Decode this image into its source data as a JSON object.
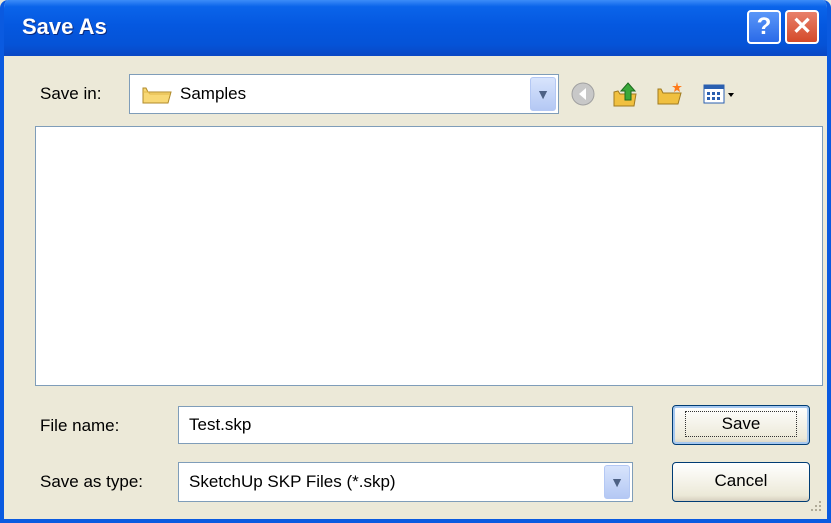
{
  "window": {
    "title": "Save As"
  },
  "titlebar": {
    "help_label": "?",
    "close_label": "✕"
  },
  "save_in": {
    "label": "Save in:",
    "value": "Samples",
    "icon": "folder-icon"
  },
  "toolbar": {
    "icons": [
      "back-icon",
      "up-folder-icon",
      "new-folder-icon",
      "views-menu-icon"
    ]
  },
  "file_name": {
    "label": "File name:",
    "value": "Test.skp"
  },
  "file_type": {
    "label": "Save as type:",
    "value": "SketchUp SKP Files (*.skp)"
  },
  "buttons": {
    "save": "Save",
    "cancel": "Cancel"
  },
  "colors": {
    "titlebar": "#0558e0",
    "dialog": "#ece9d8",
    "close": "#d44a2a"
  }
}
